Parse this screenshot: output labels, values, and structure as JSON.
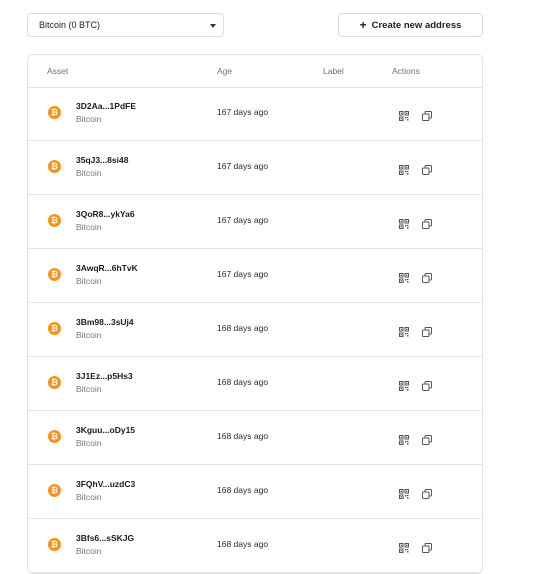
{
  "asset_select": {
    "value": "Bitcoin (0 BTC)",
    "icon": "caret-down-icon"
  },
  "create_button": {
    "label": "Create new address",
    "icon": "+"
  },
  "table": {
    "headers": {
      "asset": "Asset",
      "age": "Age",
      "label": "Label",
      "actions": "Actions"
    },
    "rows": [
      {
        "address": "3D2Aa...1PdFE",
        "chain": "Bitcoin",
        "age": "167 days ago",
        "label": ""
      },
      {
        "address": "35qJ3...8si48",
        "chain": "Bitcoin",
        "age": "167 days ago",
        "label": ""
      },
      {
        "address": "3QoR8...ykYa6",
        "chain": "Bitcoin",
        "age": "167 days ago",
        "label": ""
      },
      {
        "address": "3AwqR...6hTvK",
        "chain": "Bitcoin",
        "age": "167 days ago",
        "label": ""
      },
      {
        "address": "3Bm98...3sUj4",
        "chain": "Bitcoin",
        "age": "168 days ago",
        "label": ""
      },
      {
        "address": "3J1Ez...p5Hs3",
        "chain": "Bitcoin",
        "age": "168 days ago",
        "label": ""
      },
      {
        "address": "3Kguu...oDy15",
        "chain": "Bitcoin",
        "age": "168 days ago",
        "label": ""
      },
      {
        "address": "3FQhV...uzdC3",
        "chain": "Bitcoin",
        "age": "168 days ago",
        "label": ""
      },
      {
        "address": "3Bfs6...sSKJG",
        "chain": "Bitcoin",
        "age": "168 days ago",
        "label": ""
      }
    ]
  },
  "colors": {
    "bitcoin": "#f7931a",
    "border": "#e2e2e2",
    "muted_text": "#777777"
  },
  "icons": {
    "coin": "bitcoin-icon",
    "qr": "qr-code-icon",
    "copy": "copy-icon"
  }
}
